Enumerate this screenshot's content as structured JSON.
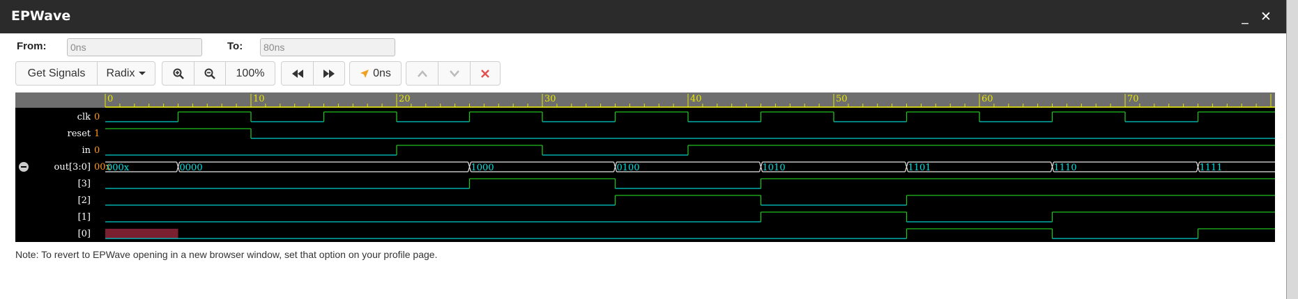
{
  "window": {
    "title": "EPWave"
  },
  "titlebar": {
    "minimize_glyph": "_",
    "close_glyph": "✕"
  },
  "range": {
    "from_label": "From:",
    "from_value": "0ns",
    "to_label": "To:",
    "to_value": "80ns"
  },
  "toolbar": {
    "get_signals": "Get Signals",
    "radix": "Radix",
    "zoom_level": "100%",
    "cursor_time": "0ns",
    "icons": [
      "zoom-in-icon",
      "zoom-out-icon",
      "rewind-icon",
      "fast-forward-icon",
      "cursor-arrow-icon",
      "chevron-up-icon",
      "chevron-down-icon",
      "remove-icon"
    ]
  },
  "waveform": {
    "time_range_ns": [
      0,
      80
    ],
    "ruler_ticks": [
      "0",
      "10",
      "20",
      "30",
      "40",
      "50",
      "60",
      "70"
    ],
    "signals": [
      {
        "name": "clk",
        "value": "0",
        "kind": "bit",
        "transitions": [
          [
            0,
            0
          ],
          [
            5,
            1
          ],
          [
            10,
            0
          ],
          [
            15,
            1
          ],
          [
            20,
            0
          ],
          [
            25,
            1
          ],
          [
            30,
            0
          ],
          [
            35,
            1
          ],
          [
            40,
            0
          ],
          [
            45,
            1
          ],
          [
            50,
            0
          ],
          [
            55,
            1
          ],
          [
            60,
            0
          ],
          [
            65,
            1
          ],
          [
            70,
            0
          ],
          [
            75,
            1
          ]
        ]
      },
      {
        "name": "reset",
        "value": "1",
        "kind": "bit",
        "transitions": [
          [
            0,
            1
          ],
          [
            10,
            0
          ]
        ]
      },
      {
        "name": "in",
        "value": "0",
        "kind": "bit",
        "transitions": [
          [
            0,
            0
          ],
          [
            20,
            1
          ],
          [
            30,
            0
          ],
          [
            40,
            1
          ]
        ]
      },
      {
        "name": "out[3:0]",
        "value": "00x",
        "kind": "bus",
        "collapse_icon": "collapse-icon",
        "segments": [
          [
            0,
            "000x"
          ],
          [
            5,
            "0000"
          ],
          [
            25,
            "1000"
          ],
          [
            35,
            "0100"
          ],
          [
            45,
            "1010"
          ],
          [
            55,
            "1101"
          ],
          [
            65,
            "1110"
          ],
          [
            75,
            "1111"
          ]
        ]
      },
      {
        "name": "[3]",
        "value": "",
        "kind": "bit",
        "transitions": [
          [
            0,
            0
          ],
          [
            25,
            1
          ],
          [
            35,
            0
          ],
          [
            45,
            1
          ]
        ]
      },
      {
        "name": "[2]",
        "value": "",
        "kind": "bit",
        "transitions": [
          [
            0,
            0
          ],
          [
            35,
            1
          ],
          [
            45,
            0
          ],
          [
            55,
            1
          ]
        ]
      },
      {
        "name": "[1]",
        "value": "",
        "kind": "bit",
        "transitions": [
          [
            0,
            0
          ],
          [
            45,
            1
          ],
          [
            55,
            0
          ],
          [
            65,
            1
          ]
        ]
      },
      {
        "name": "[0]",
        "value": "",
        "kind": "bit",
        "unknown_until": 5,
        "transitions": [
          [
            0,
            0
          ],
          [
            55,
            1
          ],
          [
            65,
            0
          ],
          [
            75,
            1
          ]
        ]
      }
    ],
    "colors": {
      "background": "#000000",
      "ruler": "#6e6e6e",
      "ruler_ticks": "#e8e800",
      "wave_low": "#00d0d0",
      "wave_high": "#22c022",
      "bus_text": "#00e0e0",
      "bus_outline": "#e8e8e8",
      "unknown_fill": "#7a2030",
      "signal_name": "#ffffff",
      "signal_value": "#ff9a1a"
    }
  },
  "note": "Note: To revert to EPWave opening in a new browser window, set that option on your profile page."
}
